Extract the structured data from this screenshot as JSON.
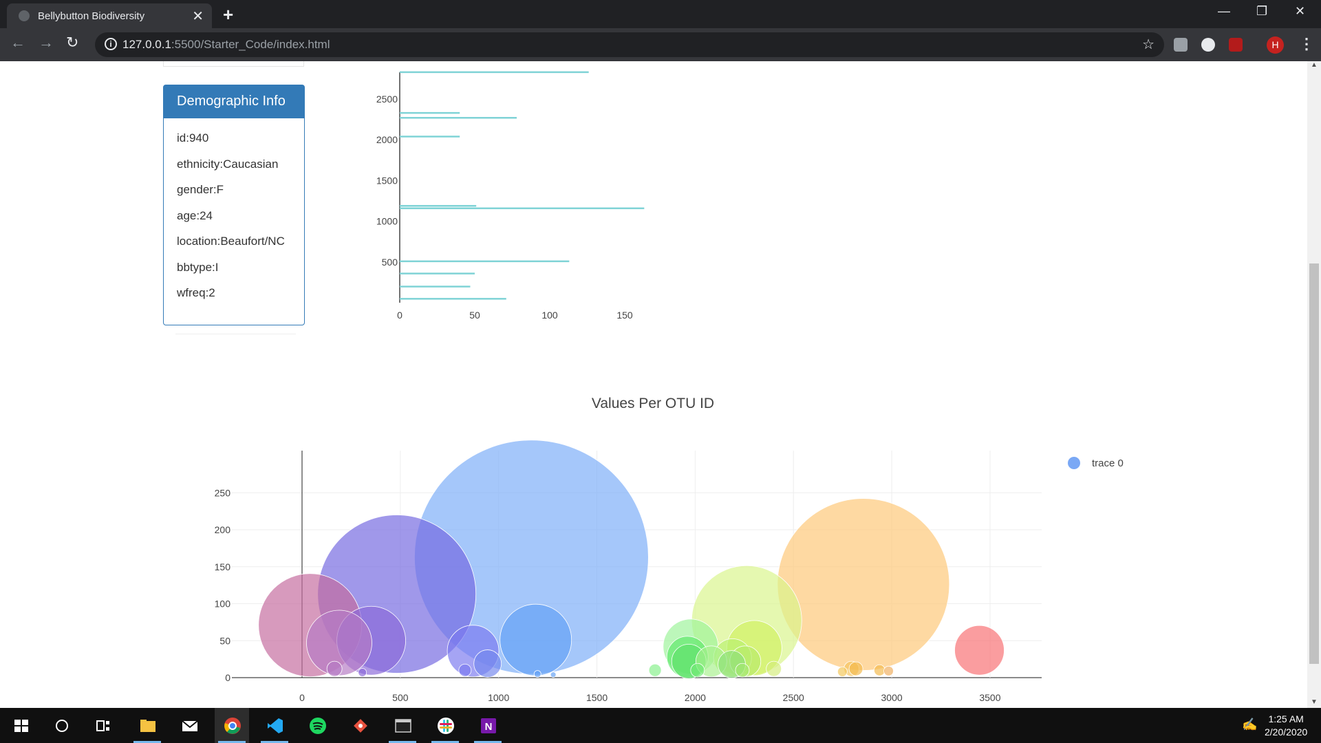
{
  "browser": {
    "tab_title": "Bellybutton Biodiversity",
    "url_host": "127.0.0.1",
    "url_path": ":5500/Starter_Code/index.html",
    "profile_initial": "H"
  },
  "panel": {
    "title": "Demographic Info",
    "rows": [
      "id:940",
      "ethnicity:Caucasian",
      "gender:F",
      "age:24",
      "location:Beaufort/NC",
      "bbtype:I",
      "wfreq:2"
    ]
  },
  "chart_data": [
    {
      "type": "bar",
      "orientation": "horizontal",
      "color": "#7fd3d6",
      "title": "",
      "xlim": [
        0,
        163
      ],
      "ylim": [
        0,
        2950
      ],
      "xticks": [
        0,
        50,
        100,
        150
      ],
      "yticks": [
        500,
        1000,
        1500,
        2000,
        2500
      ],
      "bars": [
        {
          "y": 2830,
          "x": 126
        },
        {
          "y": 2330,
          "x": 40
        },
        {
          "y": 2270,
          "x": 78
        },
        {
          "y": 2040,
          "x": 40
        },
        {
          "y": 1190,
          "x": 51
        },
        {
          "y": 1160,
          "x": 163
        },
        {
          "y": 510,
          "x": 113
        },
        {
          "y": 360,
          "x": 50
        },
        {
          "y": 200,
          "x": 47
        },
        {
          "y": 50,
          "x": 71
        }
      ]
    },
    {
      "type": "scatter",
      "mode": "markers (bubble)",
      "title": "Values Per OTU ID",
      "legend": [
        "trace 0"
      ],
      "legend_position": "top-right",
      "legend_color": "#7aa8f5",
      "xlim": [
        -350,
        3760
      ],
      "ylim": [
        -2,
        297
      ],
      "xticks": [
        0,
        500,
        1000,
        1500,
        2000,
        2500,
        3000,
        3500
      ],
      "yticks": [
        0,
        50,
        100,
        150,
        200,
        250
      ],
      "grid": true,
      "points": [
        {
          "x": 41,
          "y": 71,
          "size": 150,
          "color": "#c46a9e"
        },
        {
          "x": 482,
          "y": 113,
          "size": 230,
          "color": "#7367e0"
        },
        {
          "x": 189,
          "y": 47,
          "size": 95,
          "color": "#b57ac4"
        },
        {
          "x": 352,
          "y": 50,
          "size": 100,
          "color": "#8a69d8"
        },
        {
          "x": 165,
          "y": 12,
          "size": 22,
          "color": "#b57ac4"
        },
        {
          "x": 307,
          "y": 7,
          "size": 12,
          "color": "#8a69d8"
        },
        {
          "x": 1167,
          "y": 163,
          "size": 340,
          "color": "#7aadf7"
        },
        {
          "x": 1189,
          "y": 51,
          "size": 104,
          "color": "#63a0f5"
        },
        {
          "x": 870,
          "y": 36,
          "size": 75,
          "color": "#7a79ef"
        },
        {
          "x": 944,
          "y": 19,
          "size": 40,
          "color": "#7488ee"
        },
        {
          "x": 829,
          "y": 10,
          "size": 18,
          "color": "#7a79ef"
        },
        {
          "x": 1198,
          "y": 5,
          "size": 10,
          "color": "#63a0f5"
        },
        {
          "x": 1278,
          "y": 4,
          "size": 8,
          "color": "#63a0f5"
        },
        {
          "x": 1796,
          "y": 10,
          "size": 18,
          "color": "#86f08a"
        },
        {
          "x": 1977,
          "y": 42,
          "size": 80,
          "color": "#9cf39a"
        },
        {
          "x": 1961,
          "y": 28,
          "size": 60,
          "color": "#5ee86a"
        },
        {
          "x": 1968,
          "y": 22,
          "size": 50,
          "color": "#5fe26c"
        },
        {
          "x": 2012,
          "y": 10,
          "size": 20,
          "color": "#74ea78"
        },
        {
          "x": 2082,
          "y": 22,
          "size": 45,
          "color": "#a8f08d"
        },
        {
          "x": 2190,
          "y": 27,
          "size": 55,
          "color": "#b8f070"
        },
        {
          "x": 2262,
          "y": 77,
          "size": 160,
          "color": "#d8f58a"
        },
        {
          "x": 2301,
          "y": 40,
          "size": 80,
          "color": "#d0f060"
        },
        {
          "x": 2255,
          "y": 22,
          "size": 45,
          "color": "#b8ea6a"
        },
        {
          "x": 2186,
          "y": 18,
          "size": 40,
          "color": "#8ee07a"
        },
        {
          "x": 2240,
          "y": 10,
          "size": 20,
          "color": "#a2e870"
        },
        {
          "x": 2400,
          "y": 12,
          "size": 22,
          "color": "#d4ee7c"
        },
        {
          "x": 2749,
          "y": 8,
          "size": 14,
          "color": "#f3c75a"
        },
        {
          "x": 2795,
          "y": 12,
          "size": 22,
          "color": "#f5c460"
        },
        {
          "x": 2818,
          "y": 12,
          "size": 20,
          "color": "#f3b94d"
        },
        {
          "x": 2938,
          "y": 10,
          "size": 16,
          "color": "#f3b94d"
        },
        {
          "x": 2984,
          "y": 9,
          "size": 14,
          "color": "#f0b060"
        },
        {
          "x": 2856,
          "y": 126,
          "size": 250,
          "color": "#fdc776"
        },
        {
          "x": 3446,
          "y": 37,
          "size": 72,
          "color": "#f76e72"
        }
      ]
    }
  ],
  "taskbar": {
    "time": "1:25 AM",
    "date": "2/20/2020"
  }
}
